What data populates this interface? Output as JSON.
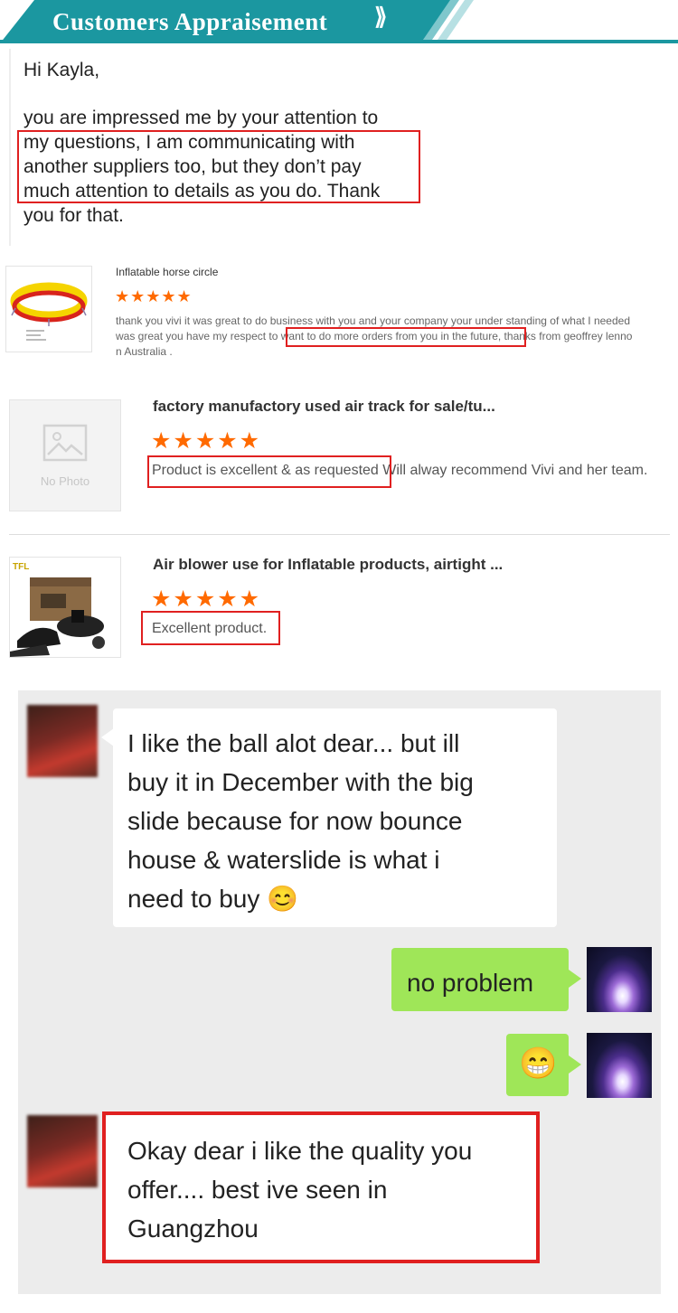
{
  "banner": {
    "title": "Customers Appraisement",
    "chevron": "⟫"
  },
  "email": {
    "greeting": "Hi Kayla,",
    "lines": [
      "you are impressed me by your attention to",
      "my questions, I am communicating with",
      "another suppliers too, but they don’t pay",
      "much attention to details as you do. Thank",
      "you for that."
    ]
  },
  "reviews": [
    {
      "title": "Inflatable horse circle",
      "stars": "★★★★★",
      "line1_pre": "thank you vivi it was great to do business with you and your company your under standing of what I needed",
      "line2_pre": "was great you have my respect to ",
      "line2_highlight": "want to do more orders from you in the future",
      "line2_post": ", thanks from geoffrey lenno",
      "line3": "n Australia ."
    },
    {
      "title": "factory manufactory used air track for sale/tu...",
      "stars": "★★★★★",
      "highlight": "Product is excellent & as requested",
      "rest": " Will alway recommend Vivi and her team.",
      "image_alt": "No Photo"
    },
    {
      "title": "Air blower use for Inflatable products, airtight ...",
      "stars": "★★★★★",
      "highlight": "Excellent product.",
      "brand": "TFL"
    }
  ],
  "chat": {
    "msg1": [
      "I like the ball alot dear... but ill",
      "buy it in December with the big",
      "slide because for now bounce",
      "house & waterslide  is what i",
      "need to buy"
    ],
    "msg1_emoji": "😊",
    "msg2": "no problem",
    "msg3_emoji": "😁",
    "msg4": [
      "Okay dear i like the quality you",
      "offer.... best ive seen in",
      "Guangzhou"
    ]
  },
  "colors": {
    "banner": "#1b97a0",
    "star": "#ff6a00",
    "highlight_box": "#e02020",
    "sent_bubble": "#9fe658",
    "chat_bg": "#ececec"
  }
}
